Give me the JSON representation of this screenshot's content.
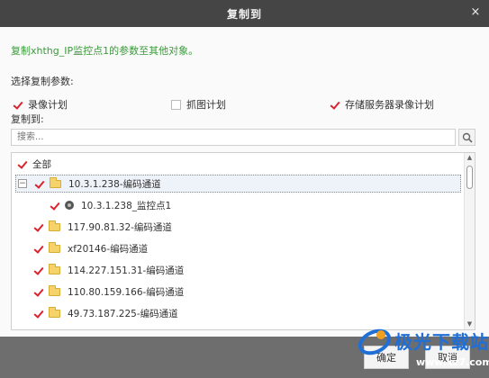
{
  "dialog": {
    "title": "复制到",
    "close": "×"
  },
  "description": "复制xhthg_IP监控点1的参数至其他对象。",
  "params_label": "选择复制参数:",
  "options": [
    {
      "label": "录像计划",
      "checked": true
    },
    {
      "label": "抓图计划",
      "checked": false
    },
    {
      "label": "存储服务器录像计划",
      "checked": true
    }
  ],
  "copy_to_label": "复制到:",
  "search": {
    "placeholder": "搜索..."
  },
  "tree": {
    "root": "全部",
    "items": [
      {
        "label": "10.3.1.238-编码通道",
        "type": "folder",
        "expanded": true,
        "checked": true
      },
      {
        "label": "10.3.1.238_监控点1",
        "type": "camera",
        "checked": true
      },
      {
        "label": "117.90.81.32-编码通道",
        "type": "folder",
        "checked": true
      },
      {
        "label": "xf20146-编码通道",
        "type": "folder",
        "checked": true
      },
      {
        "label": "114.227.151.31-编码通道",
        "type": "folder",
        "checked": true
      },
      {
        "label": "110.80.159.166-编码通道",
        "type": "folder",
        "checked": true
      },
      {
        "label": "49.73.187.225-编码通道",
        "type": "folder",
        "checked": true
      }
    ]
  },
  "footer": {
    "ok": "确定",
    "cancel": "取消"
  },
  "watermark": {
    "text": "极光下载站",
    "url": "www.xz7.com"
  }
}
